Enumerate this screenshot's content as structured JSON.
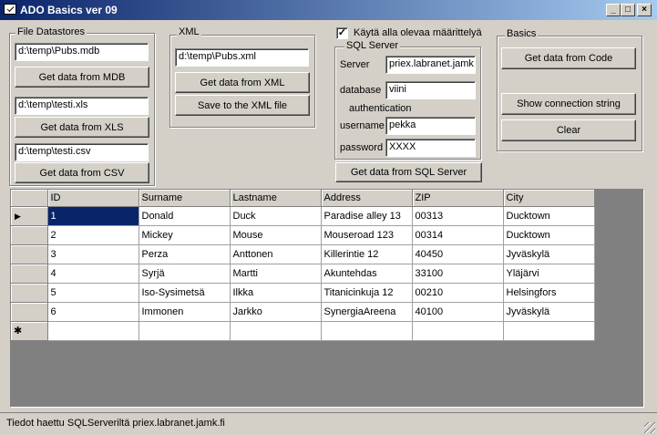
{
  "window": {
    "title": "ADO Basics ver 09",
    "minimize": "_",
    "maximize": "□",
    "close": "×"
  },
  "file_datastores": {
    "label": "File Datastores",
    "mdb_path": "d:\\temp\\Pubs.mdb",
    "mdb_button": "Get data from MDB",
    "xls_path": "d:\\temp\\testi.xls",
    "xls_button": "Get data from XLS",
    "csv_path": "d:\\temp\\testi.csv",
    "csv_button": "Get data from CSV"
  },
  "xml": {
    "label": "XML",
    "path": "d:\\temp\\Pubs.xml",
    "get_button": "Get data from XML",
    "save_button": "Save to the XML file"
  },
  "sql": {
    "checkbox_label": "Käytä alla olevaa määrittelyä",
    "checkbox_mark": "✓",
    "group_label": "SQL Server",
    "server_label": "Server",
    "server_value": "priex.labranet.jamk.fi",
    "database_label": "database",
    "database_value": "viini",
    "auth_label": "authentication",
    "username_label": "username",
    "username_value": "pekka",
    "password_label": "password",
    "password_value": "XXXX",
    "get_button": "Get data from SQL Server"
  },
  "basics": {
    "label": "Basics",
    "code_button": "Get data from Code",
    "conn_button": "Show connection string",
    "clear_button": "Clear"
  },
  "grid": {
    "columns": [
      "ID",
      "Surname",
      "Lastname",
      "Address",
      "ZIP",
      "City"
    ],
    "rows": [
      [
        "1",
        "Donald",
        "Duck",
        "Paradise alley 13",
        "00313",
        "Ducktown"
      ],
      [
        "2",
        "Mickey",
        "Mouse",
        "Mouseroad 123",
        "00314",
        "Ducktown"
      ],
      [
        "3",
        "Perza",
        "Anttonen",
        "Killerintie 12",
        "40450",
        "Jyväskylä"
      ],
      [
        "4",
        "Syrjä",
        "Martti",
        "Akuntehdas",
        "33100",
        "Yläjärvi"
      ],
      [
        "5",
        "Iso-Sysimetsä",
        "Ilkka",
        "Titanicinkuja 12",
        "00210",
        "Helsingfors"
      ],
      [
        "6",
        "Immonen",
        "Jarkko",
        "SynergiaAreena",
        "40100",
        "Jyväskylä"
      ]
    ],
    "current_row_marker": "▶",
    "new_row_marker": "✱"
  },
  "status": {
    "text": "Tiedot haettu SQLServeriltä priex.labranet.jamk.fi"
  }
}
